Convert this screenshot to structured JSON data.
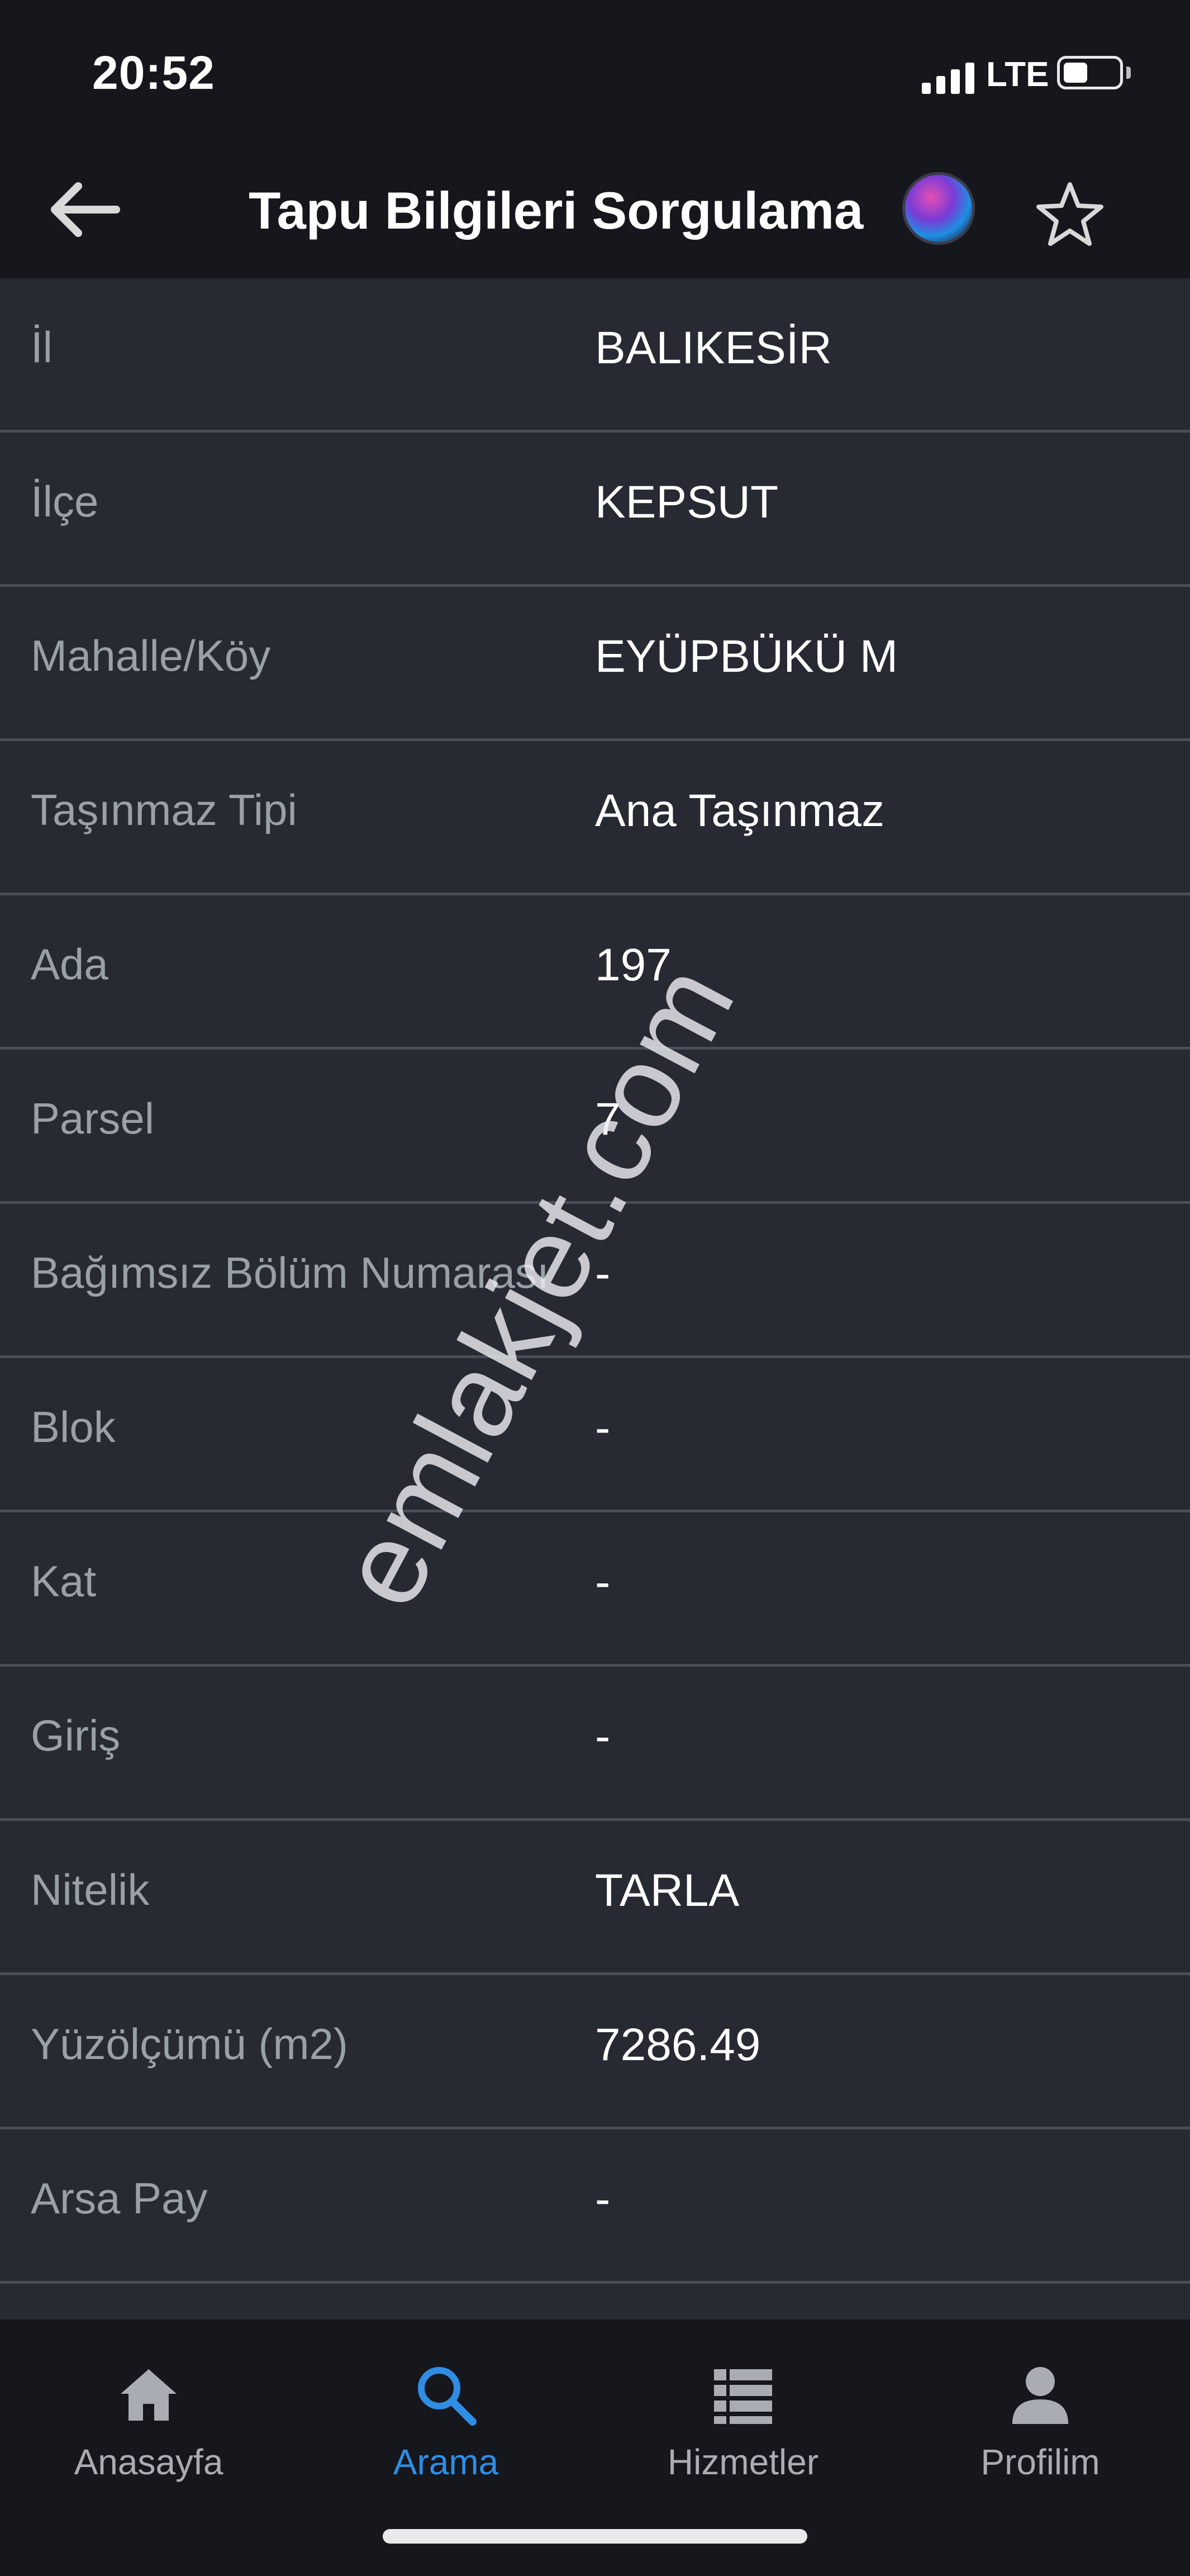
{
  "status_bar": {
    "time": "20:52",
    "network": "LTE",
    "battery_level": 0.45
  },
  "header": {
    "title": "Tapu Bilgileri Sorgulama",
    "icons": {
      "back": "arrow-left-icon",
      "assistant": "siri-icon",
      "favorite": "star-outline-icon"
    }
  },
  "rows": [
    {
      "label": "İl",
      "value": "BALIKESİR"
    },
    {
      "label": "İlçe",
      "value": "KEPSUT"
    },
    {
      "label": "Mahalle/Köy",
      "value": "EYÜPBÜKÜ M"
    },
    {
      "label": "Taşınmaz Tipi",
      "value": "Ana Taşınmaz"
    },
    {
      "label": "Ada",
      "value": "197"
    },
    {
      "label": "Parsel",
      "value": "7"
    },
    {
      "label": "Bağımsız Bölüm Numarası",
      "value": "-"
    },
    {
      "label": "Blok",
      "value": "-"
    },
    {
      "label": "Kat",
      "value": "-"
    },
    {
      "label": "Giriş",
      "value": "-"
    },
    {
      "label": "Nitelik",
      "value": "TARLA"
    },
    {
      "label": "Yüzölçümü (m2)",
      "value": "7286.49"
    },
    {
      "label": "Arsa Pay",
      "value": "-"
    }
  ],
  "watermark": "emlakjet.com",
  "tabs": [
    {
      "label": "Anasayfa",
      "icon": "home-icon",
      "active": false
    },
    {
      "label": "Arama",
      "icon": "search-icon",
      "active": true
    },
    {
      "label": "Hizmetler",
      "icon": "list-icon",
      "active": false
    },
    {
      "label": "Profilim",
      "icon": "person-icon",
      "active": false
    }
  ],
  "colors": {
    "background": "#272a33",
    "bar_background": "#15171c",
    "label": "#9aa0a8",
    "value": "#ffffff",
    "accent": "#2f8de4",
    "divider": "#4a4e57"
  }
}
